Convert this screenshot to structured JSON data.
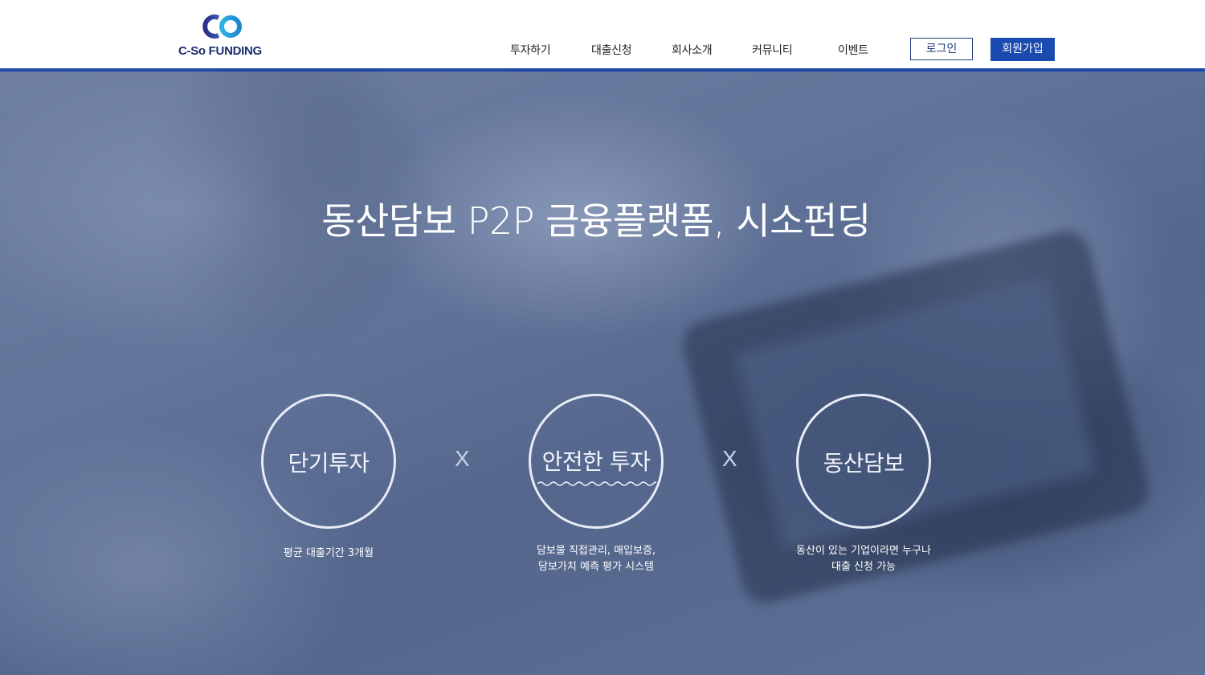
{
  "header": {
    "logo": {
      "pre": "C-So",
      "post": "FUNDING"
    },
    "nav": [
      "투자하기",
      "대출신청",
      "회사소개",
      "커뮤니티",
      "이벤트"
    ],
    "login_label": "로그인",
    "join_label": "회원가입"
  },
  "hero": {
    "title": "동산담보 P2P 금융플랫폼, 시소펀딩",
    "features": [
      {
        "label": "단기투자",
        "caption": "평균 대출기간 3개월"
      },
      {
        "label": "안전한 투자",
        "caption_line1": "담보물 직접관리, 매입보증,",
        "caption_line2": "담보가치 예측 평가 시스템"
      },
      {
        "label": "동산담보",
        "caption_line1": "동산이 있는 기업이라면 누구나",
        "caption_line2": "대출 신청 가능"
      }
    ],
    "separator": "X"
  },
  "colors": {
    "brand": "#1a4bb0",
    "header_line": "#1d4aa8",
    "logo_navy": "#1b2f6d",
    "logo_cyan": "#1ea0d8"
  }
}
